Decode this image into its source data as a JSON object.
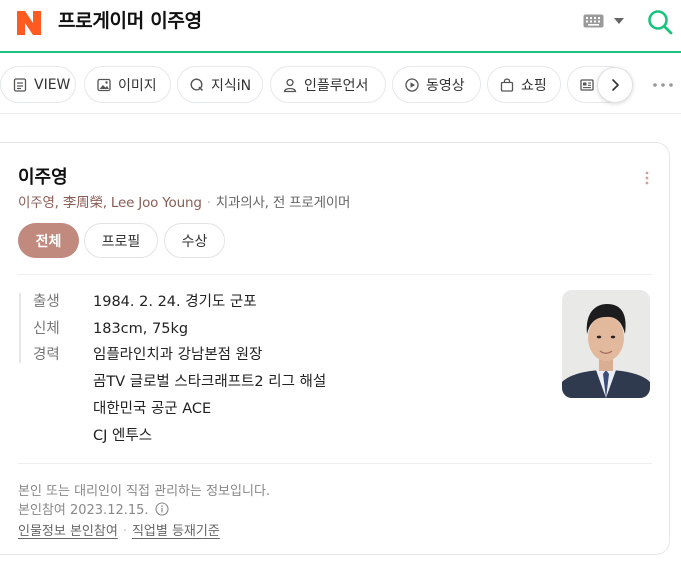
{
  "header": {
    "query": "프로게이머 이주영",
    "logo_icon": "naver-logo",
    "brand_color": "#19c37d",
    "logo_color": "#ff5a1f"
  },
  "tabs": [
    {
      "label": "VIEW",
      "icon": "document-icon"
    },
    {
      "label": "이미지",
      "icon": "image-icon"
    },
    {
      "label": "지식iN",
      "icon": "q-icon"
    },
    {
      "label": "인플루언서",
      "icon": "person-icon"
    },
    {
      "label": "동영상",
      "icon": "play-icon"
    },
    {
      "label": "쇼핑",
      "icon": "bag-icon"
    },
    {
      "label": "",
      "icon": "news-icon"
    }
  ],
  "profile": {
    "name": "이주영",
    "aliases": "이주영, 李周榮, Lee Joo Young",
    "job": "치과의사, 전 프로게이머",
    "chips": [
      "전체",
      "프로필",
      "수상"
    ],
    "info": {
      "birth_label": "출생",
      "birth_value": "1984. 2. 24. 경기도 군포",
      "body_label": "신체",
      "body_value": "183cm, 75kg",
      "career_label": "경력",
      "career": [
        "임플라인치과 강남본점 원장",
        "곰TV 글로벌 스타크래프트2 리그 해설",
        "대한민국 공군 ACE",
        "CJ 엔투스"
      ]
    },
    "notice": "본인 또는 대리인이 직접 관리하는 정보입니다.",
    "verified": "본인참여 2023.12.15.",
    "link_1": "인물정보 본인참여",
    "link_2": "직업별 등재기준",
    "accent_color": "#c08a7e"
  }
}
